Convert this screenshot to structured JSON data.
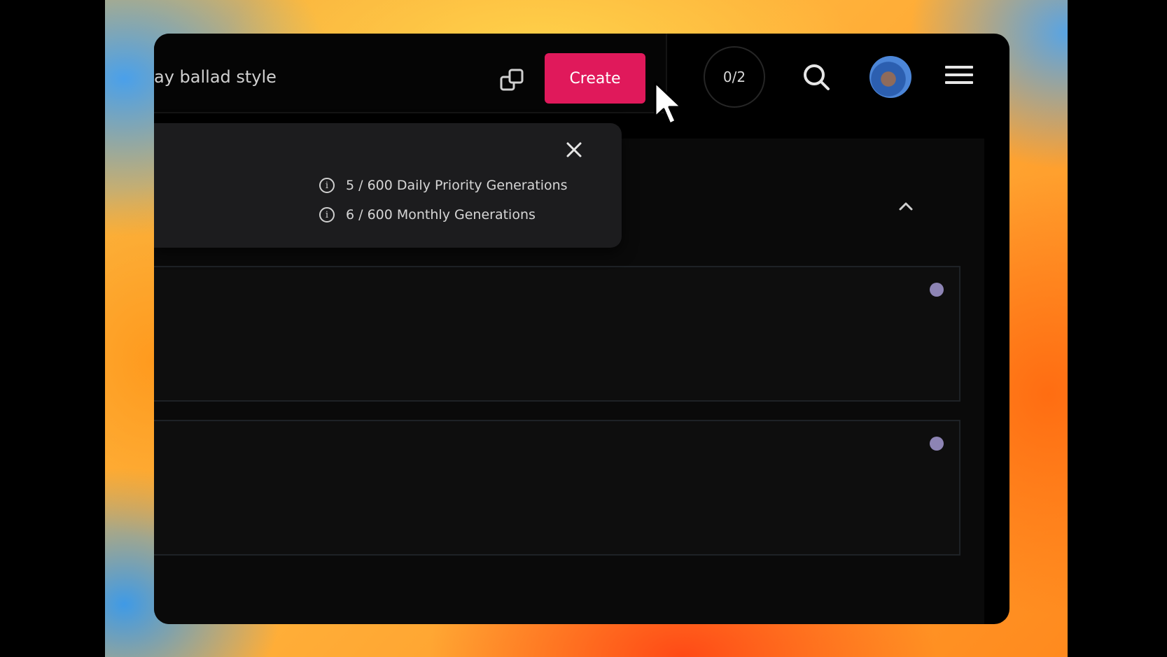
{
  "header": {
    "prompt_text": "ay ballad style",
    "create_label": "Create",
    "counter_label": "0/2"
  },
  "popover": {
    "daily_quota": "5 / 600 Daily Priority Generations",
    "monthly_quota": "6 / 600 Monthly Generations"
  },
  "icons": [
    "shuffle-icon",
    "search-icon",
    "menu-icon",
    "close-icon",
    "info-icon",
    "chevron-up-icon",
    "status-dot-icon",
    "mouse-cursor"
  ],
  "colors": {
    "accent": "#e0195b",
    "app_background": "#000000",
    "popover_background": "#1c1c1e",
    "status_dot": "#8d84b4"
  }
}
